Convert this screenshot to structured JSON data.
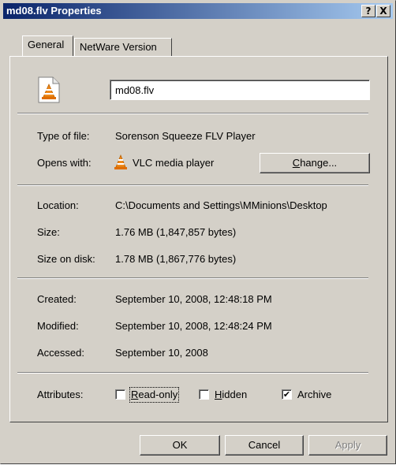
{
  "window": {
    "title": "md08.flv Properties",
    "help_glyph": "?",
    "close_glyph": "X"
  },
  "tabs": [
    {
      "label": "General"
    },
    {
      "label": "NetWare Version"
    }
  ],
  "general": {
    "file_name": "md08.flv",
    "type_label": "Type of file:",
    "type_value": "Sorenson Squeeze FLV Player",
    "opens_label": "Opens with:",
    "opens_value": "VLC media player",
    "change_button": {
      "pre": "",
      "accel": "C",
      "post": "hange..."
    },
    "location_label": "Location:",
    "location_value": "C:\\Documents and Settings\\MMinions\\Desktop",
    "size_label": "Size:",
    "size_value": "1.76 MB (1,847,857 bytes)",
    "size_disk_label": "Size on disk:",
    "size_disk_value": "1.78 MB (1,867,776 bytes)",
    "created_label": "Created:",
    "created_value": "September 10, 2008, 12:48:18 PM",
    "modified_label": "Modified:",
    "modified_value": "September 10, 2008, 12:48:24 PM",
    "accessed_label": "Accessed:",
    "accessed_value": "September 10, 2008",
    "attributes_label": "Attributes:",
    "attributes": [
      {
        "accel": "R",
        "rest": "ead-only",
        "checked": false
      },
      {
        "accel": "H",
        "rest": "idden",
        "checked": false
      },
      {
        "accel": "",
        "rest": "Archive",
        "checked": true
      }
    ],
    "check_glyph": "✔"
  },
  "buttons": {
    "ok": "OK",
    "cancel": "Cancel",
    "apply": "Apply"
  },
  "icons": {
    "file_icon": "vlc-file-icon",
    "app_icon": "vlc-cone-icon"
  }
}
